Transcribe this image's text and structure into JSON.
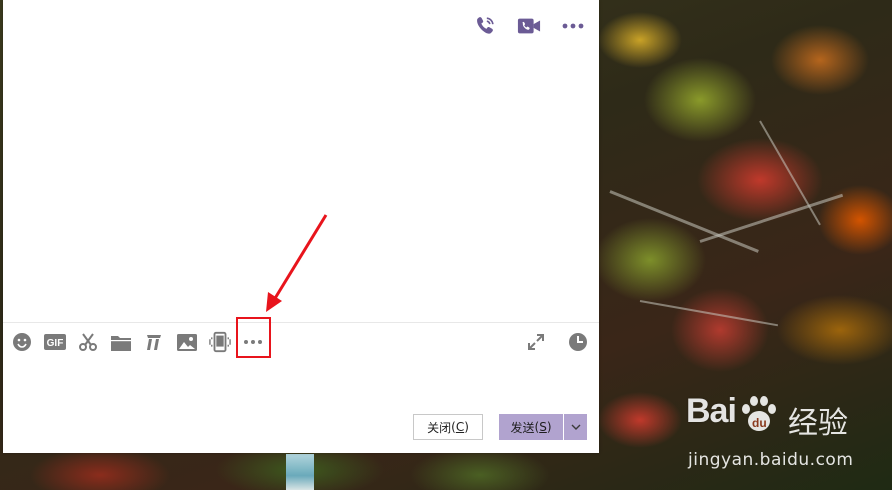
{
  "chat": {
    "close_label": "关闭",
    "close_key": "C",
    "send_label": "发送",
    "send_key": "S"
  },
  "icons": {
    "top": [
      "voice-call-icon",
      "video-call-icon",
      "more-options-icon"
    ],
    "toolbar": [
      "emoji-icon",
      "gif-icon",
      "screenshot-icon",
      "folder-icon",
      "music-icon",
      "image-icon",
      "phone-transfer-icon",
      "more-tools-icon"
    ],
    "toolbar_right": [
      "expand-icon",
      "history-icon"
    ]
  },
  "colors": {
    "accent": "#6b5b95",
    "send_button": "#b1a3cf",
    "icon_gray": "#7a7a7a",
    "highlight": "#e8141c"
  },
  "watermark": {
    "logo_text": "Bai",
    "logo_suffix": "du",
    "cn_text": "经验",
    "url": "jingyan.baidu.com"
  }
}
